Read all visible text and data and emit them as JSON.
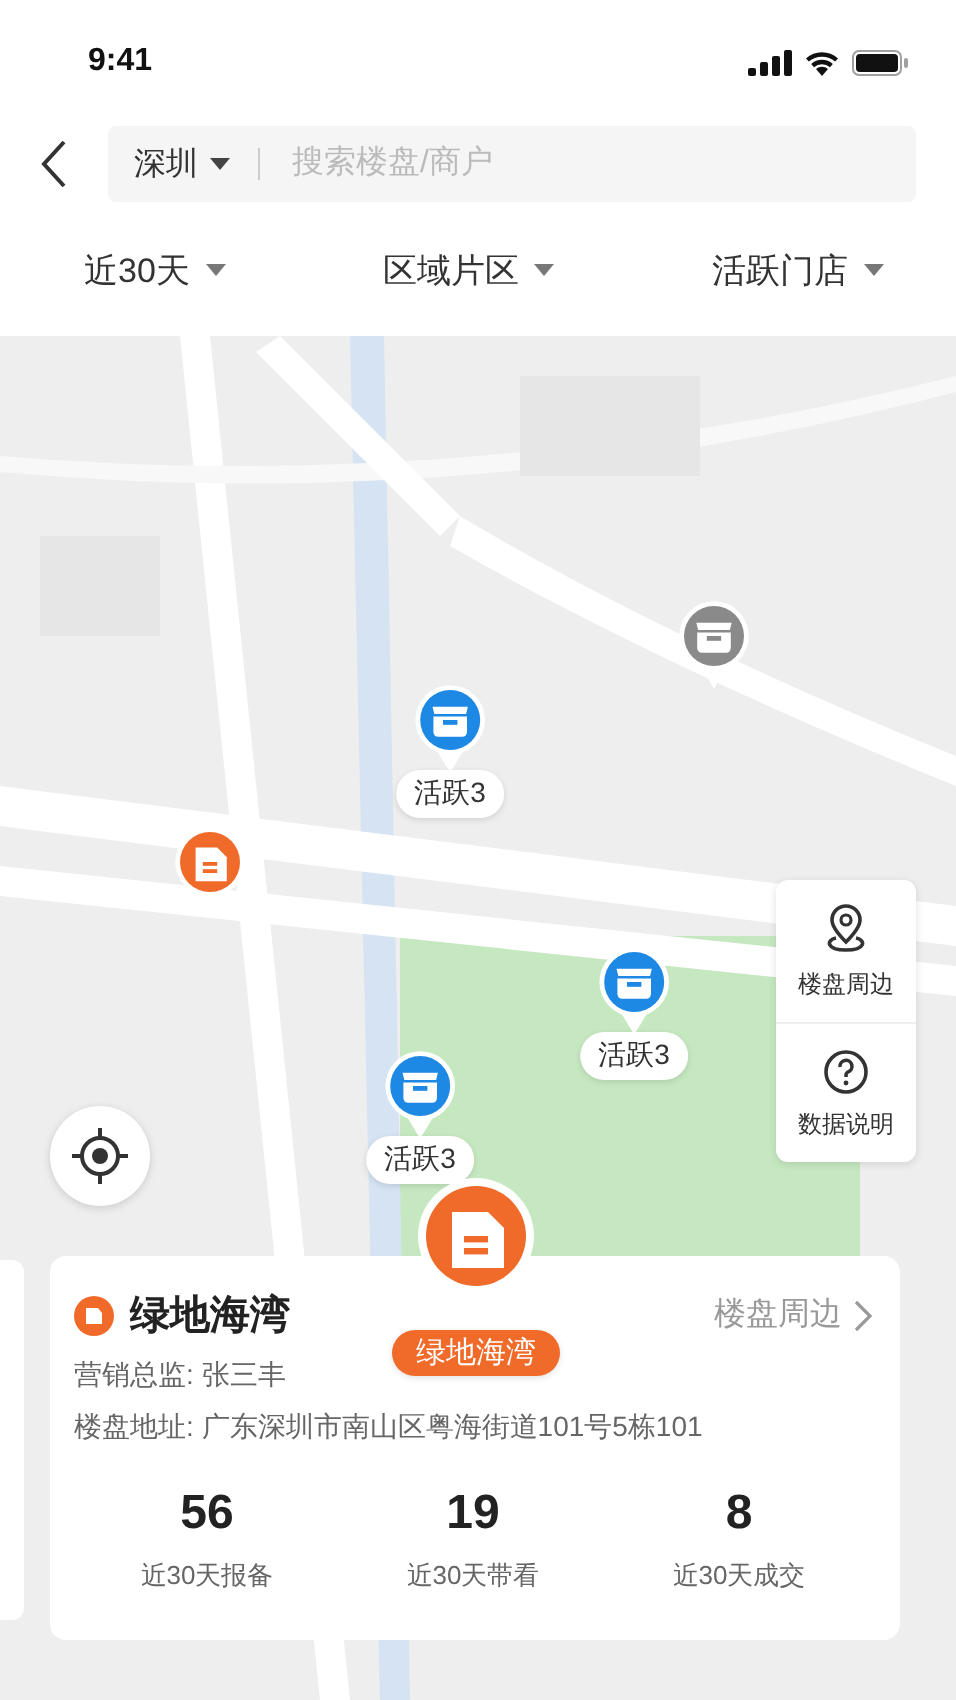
{
  "status_bar": {
    "time": "9:41"
  },
  "search": {
    "city": "深圳",
    "placeholder": "搜索楼盘/商户"
  },
  "filters": [
    {
      "label": "近30天"
    },
    {
      "label": "区域片区"
    },
    {
      "label": "活跃门店"
    }
  ],
  "markers": [
    {
      "kind": "inactive",
      "selected": false
    },
    {
      "kind": "store",
      "label": "活跃3",
      "selected": false
    },
    {
      "kind": "building",
      "selected": false
    },
    {
      "kind": "store",
      "label": "活跃3",
      "selected": false
    },
    {
      "kind": "store",
      "label": "活跃3",
      "selected": false
    },
    {
      "kind": "building",
      "label": "绿地海湾",
      "selected": true
    }
  ],
  "tools": [
    {
      "kind": "nearby",
      "label": "楼盘周边"
    },
    {
      "kind": "help",
      "label": "数据说明"
    }
  ],
  "card": {
    "title": "绿地海湾",
    "link": "楼盘周边",
    "lines": [
      "营销总监: 张三丰",
      "楼盘地址: 广东深圳市南山区粤海街道101号5栋101"
    ],
    "stats": [
      {
        "value": "56",
        "label": "近30天报备"
      },
      {
        "value": "19",
        "label": "近30天带看"
      },
      {
        "value": "8",
        "label": "近30天成交"
      }
    ]
  }
}
